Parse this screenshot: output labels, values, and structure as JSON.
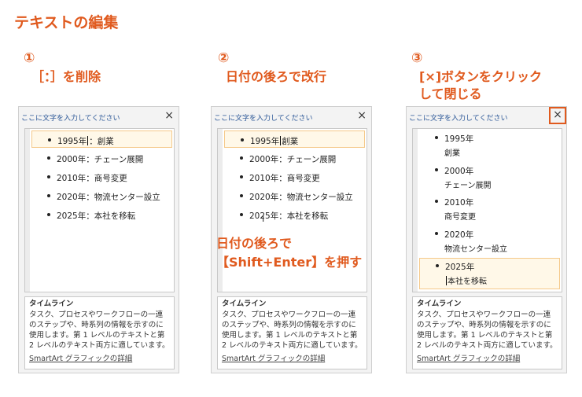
{
  "title": "テキストの編集",
  "steps": [
    {
      "num": "①",
      "text": "［：］を削除",
      "text2": ""
    },
    {
      "num": "②",
      "text": "日付の後ろで改行",
      "text2": ""
    },
    {
      "num": "③",
      "text": "[×]ボタンをクリック",
      "text2": "して閉じる"
    }
  ],
  "pane": {
    "header": "ここに文字を入力してください",
    "close": "×",
    "desc_title": "タイムライン",
    "desc_body": "タスク、プロセスやワークフローの一連のステップや、時系列の情報を示すのに使用します。第 1 レベルのテキストと第 2 レベルのテキスト両方に適しています。",
    "desc_link": "SmartArt グラフィックの詳細"
  },
  "panel1_items": [
    {
      "a": "1995年",
      "b": "：創業"
    },
    {
      "a": "2000年",
      "b": "：チェーン展開"
    },
    {
      "a": "2010年",
      "b": "：商号変更"
    },
    {
      "a": "2020年",
      "b": "：物流センター設立"
    },
    {
      "a": "2025年",
      "b": "：本社を移転"
    }
  ],
  "panel2_items": [
    {
      "a": "1995年",
      "b": "創業"
    },
    {
      "a": "2000年",
      "b": "：チェーン展開"
    },
    {
      "a": "2010年",
      "b": "：商号変更"
    },
    {
      "a": "2020年",
      "b": "：物流センター設立"
    },
    {
      "a": "2025年",
      "b": "：本社を移転"
    }
  ],
  "panel3_items": [
    {
      "a": "1995年",
      "b": "創業"
    },
    {
      "a": "2000年",
      "b": "チェーン展開"
    },
    {
      "a": "2010年",
      "b": "商号変更"
    },
    {
      "a": "2020年",
      "b": "物流センター設立"
    },
    {
      "a": "2025年",
      "b": "本社を移転"
    }
  ],
  "note": {
    "line1": "日付の後ろで",
    "line2": "【Shift+Enter】を押す"
  },
  "icons": {
    "close": "close-icon",
    "cursor": "text-cursor-icon"
  },
  "accent_color": "#e05a1e"
}
